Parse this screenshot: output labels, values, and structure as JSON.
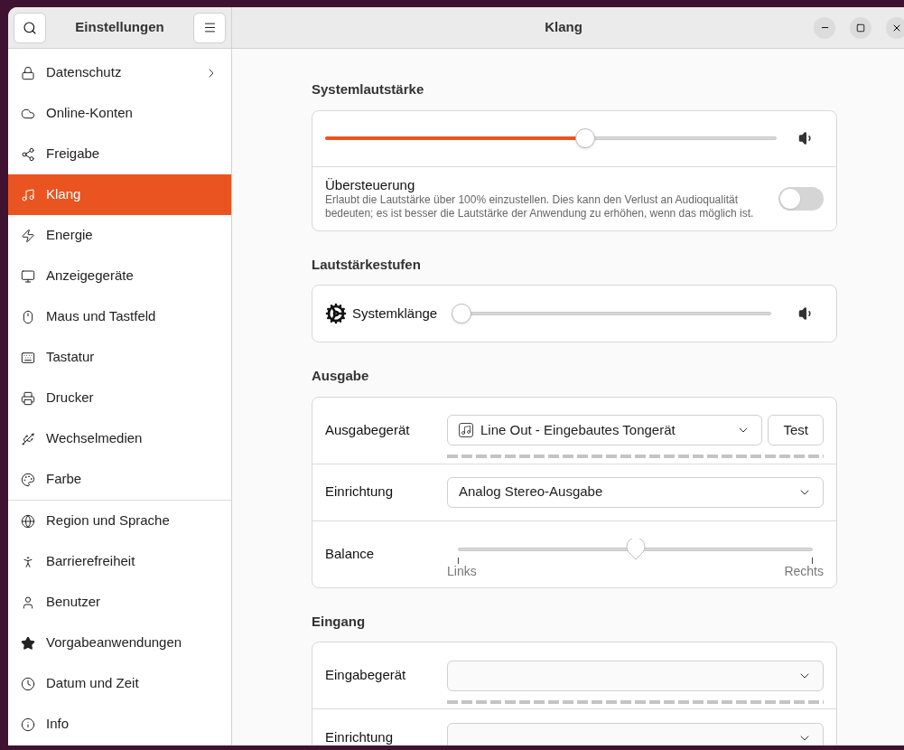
{
  "sidebar": {
    "title": "Einstellungen",
    "groups": [
      [
        {
          "label": "Datenschutz",
          "selected": false,
          "submenu": true
        },
        {
          "label": "Online-Konten",
          "selected": false,
          "submenu": false
        },
        {
          "label": "Freigabe",
          "selected": false,
          "submenu": false
        },
        {
          "label": "Klang",
          "selected": true,
          "submenu": false
        },
        {
          "label": "Energie",
          "selected": false,
          "submenu": false
        },
        {
          "label": "Anzeigegeräte",
          "selected": false,
          "submenu": false
        },
        {
          "label": "Maus und Tastfeld",
          "selected": false,
          "submenu": false
        },
        {
          "label": "Tastatur",
          "selected": false,
          "submenu": false
        },
        {
          "label": "Drucker",
          "selected": false,
          "submenu": false
        },
        {
          "label": "Wechselmedien",
          "selected": false,
          "submenu": false
        },
        {
          "label": "Farbe",
          "selected": false,
          "submenu": false
        }
      ],
      [
        {
          "label": "Region und Sprache",
          "selected": false,
          "submenu": false
        },
        {
          "label": "Barrierefreiheit",
          "selected": false,
          "submenu": false
        },
        {
          "label": "Benutzer",
          "selected": false,
          "submenu": false
        },
        {
          "label": "Vorgabeanwendungen",
          "selected": false,
          "submenu": false
        },
        {
          "label": "Datum und Zeit",
          "selected": false,
          "submenu": false
        },
        {
          "label": "Info",
          "selected": false,
          "submenu": false
        }
      ]
    ]
  },
  "window": {
    "title": "Klang"
  },
  "sections": [
    {
      "heading": "Systemlautstärke",
      "rows": [
        {
          "kind": "volume",
          "level": 0.58
        },
        {
          "kind": "toggle",
          "title": "Übersteuerung",
          "description": "Erlaubt die Lautstärke über 100% einzustellen. Dies kann den Verlust an Audioqualität bedeuten; es ist besser die Lautstärke der Anwendung zu erhöhen, wenn das möglich ist.",
          "on": false
        }
      ]
    },
    {
      "heading": "Lautstärkestufen",
      "rows": [
        {
          "kind": "app_volume",
          "label": "Systemklänge",
          "level": 0
        }
      ]
    },
    {
      "heading": "Ausgabe",
      "rows": [
        {
          "kind": "device",
          "label": "Ausgabegerät",
          "value": "Line Out - Eingebautes Tongerät",
          "button": "Test"
        },
        {
          "kind": "dropdown",
          "label": "Einrichtung",
          "value": "Analog Stereo-Ausgabe"
        },
        {
          "kind": "balance",
          "label": "Balance",
          "level": 0.5,
          "left": "Links",
          "right": "Rechts"
        }
      ]
    },
    {
      "heading": "Eingang",
      "rows": [
        {
          "kind": "device",
          "label": "Eingabegerät"
        },
        {
          "kind": "dropdown",
          "label": "Einrichtung"
        }
      ]
    }
  ]
}
